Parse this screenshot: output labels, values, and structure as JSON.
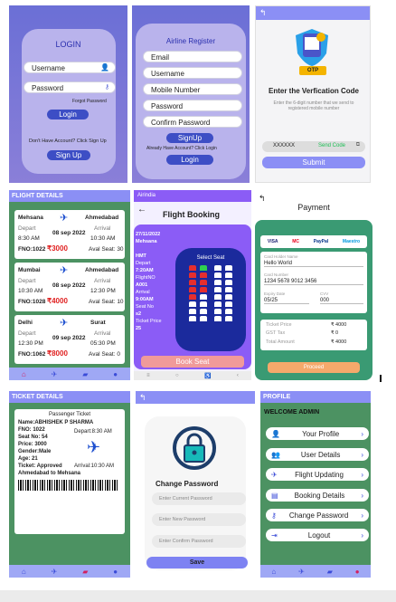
{
  "login": {
    "title": "LOGIN",
    "username": "Username",
    "password": "Password",
    "forgot": "Forgot Password",
    "login_btn": "Login",
    "no_account": "Don't Have Account? Click Sign Up",
    "signup_btn": "Sign Up"
  },
  "register": {
    "title": "Airline Register",
    "email": "Email",
    "username": "Username",
    "mobile": "Mobile Number",
    "password": "Password",
    "confirm": "Confirm Password",
    "signup_btn": "SignUp",
    "already": "Already Have Account? Click Login",
    "login_btn": "Login"
  },
  "otp": {
    "badge": "OTP",
    "title": "Enter the Verfication Code",
    "subtitle": "Enter the 6-digit number that we send to registered mobile number",
    "code": "XXXXXX",
    "send": "Send Code",
    "submit": "Submit"
  },
  "flight_details": {
    "header": "FLIGHT DETAILS",
    "flights": [
      {
        "from": "Mehsana",
        "to": "Ahmedabad",
        "depart_label": "Depart",
        "arrival_label": "Arrival",
        "date": "08 sep 2022",
        "depart": "8:30 AM",
        "arrival": "10:30 AM",
        "fno": "FNO:1022",
        "price": "₹3000",
        "seats": "Aval Seat: 30"
      },
      {
        "from": "Mumbai",
        "to": "Ahmedabad",
        "depart_label": "Depart",
        "arrival_label": "Arrival",
        "date": "08 sep 2022",
        "depart": "10:30 AM",
        "arrival": "12:30 PM",
        "fno": "FNO:1028",
        "price": "₹4000",
        "seats": "Aval Seat: 10"
      },
      {
        "from": "Delhi",
        "to": "Surat",
        "depart_label": "Depart",
        "arrival_label": "Arrival",
        "date": "09 sep 2022",
        "depart": "12:30 PM",
        "arrival": "05:30 PM",
        "fno": "FNO:1062",
        "price": "₹8000",
        "seats": "Aval Seat: 0"
      }
    ]
  },
  "booking": {
    "appbar": "Airindia",
    "title": "Flight Booking",
    "date": "27/11/2022",
    "city": "Mehsana",
    "code": "HMT",
    "depart_label": "Depart",
    "depart": "7:20AM",
    "flight_label": "FlightNO",
    "flight": "A001",
    "arrival_label": "Arrival",
    "arrival": "9:00AM",
    "seat_label": "Seat No",
    "seat": "s2",
    "price_label": "Ticket Price",
    "price": "25",
    "select_seat": "Select Seat",
    "book_btn": "Book Seat"
  },
  "payment": {
    "title": "Payment",
    "cards": [
      "VISA",
      "MC",
      "PayPal",
      "Maestro"
    ],
    "holder_label": "Card Holder Name",
    "holder": "Hello World",
    "number_label": "Card Number",
    "number": "1234 5678 9012 3456",
    "expiry_label": "Expiry Date",
    "expiry": "05/25",
    "cvv_label": "CVV",
    "cvv": "000",
    "ticket_label": "Ticket Price",
    "ticket": "₹ 4000",
    "gst_label": "GST Tax",
    "gst": "₹ 0",
    "total_label": "Total Amount",
    "total": "₹ 4000",
    "proceed": "Proceed"
  },
  "ticket": {
    "header": "TICKET DETAILS",
    "title": "Passenger Ticket",
    "name": "Name:ABHISHEK P SHARMA",
    "fno": "FNO: 1022",
    "depart": "Depart:8:30 AM",
    "seat": "Seat No: 54",
    "price": "Price: 3000",
    "gender": "Gender:Male",
    "age": "Age: 21",
    "status": "Ticket: Approved",
    "arrival": "Arrival:10:30 AM",
    "route": "Ahmedabad to Mehsana"
  },
  "change_password": {
    "title": "Change Password",
    "current": "Enter Current Password",
    "new": "Enter New Password",
    "confirm": "Enter Confirm Password",
    "save": "Save"
  },
  "profile": {
    "header": "PROFILE",
    "welcome": "WELCOME ADMIN",
    "items": [
      "Your Profile",
      "User Details",
      "Flight Updating",
      "Booking Details",
      "Change Password",
      "Logout"
    ]
  }
}
